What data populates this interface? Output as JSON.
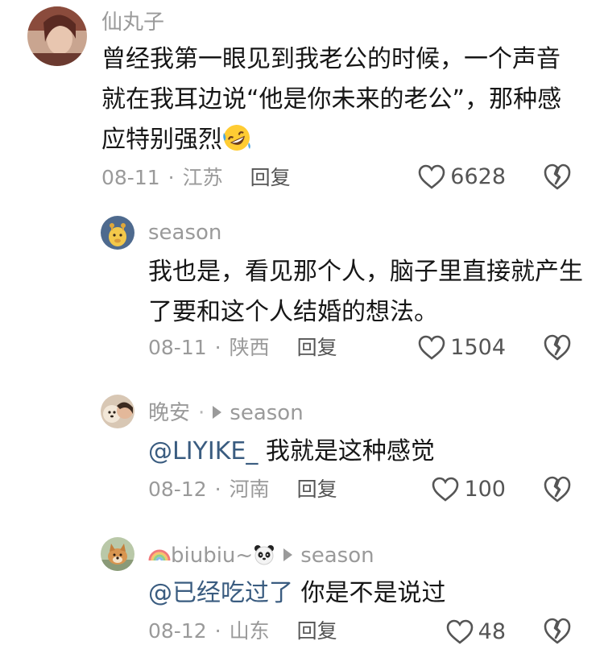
{
  "comments": [
    {
      "username": "仙丸子",
      "text": "曾经我第一眼见到我老公的时候，一个声音就在我耳边说“他是你未来的老公”，那种感应特别强烈",
      "emoji": "rofl-emoji",
      "date": "08-11",
      "location": "江苏",
      "reply_label": "回复",
      "likes": "6628"
    },
    {
      "username": "season",
      "text": "我也是，看见那个人，脑子里直接就产生了要和这个人结婚的想法。",
      "date": "08-11",
      "location": "陕西",
      "reply_label": "回复",
      "likes": "1504"
    },
    {
      "username": "晚安",
      "separator": "·",
      "reply_to": "season",
      "mention": "@LIYIKE_",
      "text": " 我就是这种感觉",
      "date": "08-12",
      "location": "河南",
      "reply_label": "回复",
      "likes": "100"
    },
    {
      "username": "biubiu~",
      "username_prefix_icon": "rainbow-icon",
      "username_suffix_icon": "panda-icon",
      "reply_to": "season",
      "mention": "@已经吃过了",
      "text": " 你是不是说过",
      "date": "08-12",
      "location": "山东",
      "reply_label": "回复",
      "likes": "48"
    }
  ],
  "colors": {
    "text": "#161616",
    "muted": "#9a9a9a",
    "mention": "#3a5c80",
    "icon": "#555555"
  }
}
